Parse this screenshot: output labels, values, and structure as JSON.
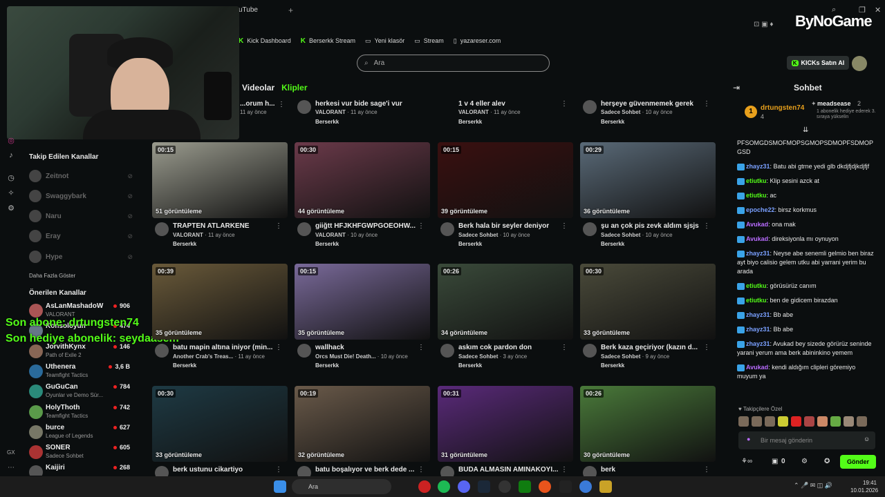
{
  "browser": {
    "tab_title": "uTube",
    "bookmarks": [
      "Kick Dashboard",
      "Berserkk Stream",
      "Yeni klasör",
      "Stream",
      "yazareser.com"
    ]
  },
  "search": {
    "placeholder": "Ara"
  },
  "tabs": {
    "videos": "Videolar",
    "clips": "Klipler"
  },
  "overlay": {
    "line1": "Son abone: drtungsten74",
    "line2": "Son hediye abonelik: seydaasem"
  },
  "sidebar": {
    "followed_title": "Takip Edilen Kanallar",
    "followed": [
      "Zeitnot",
      "Swaggybark",
      "Naru",
      "Eray",
      "Hype"
    ],
    "show_more": "Daha Fazla Göster",
    "recommended_title": "Önerilen Kanallar",
    "recommended": [
      {
        "name": "AsLanMashadoW",
        "category": "VALORANT",
        "viewers": "906"
      },
      {
        "name": "Konsoloyun",
        "category": "",
        "viewers": "474"
      },
      {
        "name": "JorvithKynx",
        "category": "Path of Exile 2",
        "viewers": "146"
      },
      {
        "name": "Uthenera",
        "category": "Teamfight Tactics",
        "viewers": "3,6 B"
      },
      {
        "name": "GuGuCan",
        "category": "Oyunlar ve Demo Sür...",
        "viewers": "784"
      },
      {
        "name": "HolyThoth",
        "category": "Teamfight Tactics",
        "viewers": "742"
      },
      {
        "name": "burce",
        "category": "League of Legends",
        "viewers": "627"
      },
      {
        "name": "SONER",
        "category": "Sadece Sohbet",
        "viewers": "605"
      },
      {
        "name": "Kaijiri",
        "category": "",
        "viewers": "268"
      }
    ]
  },
  "top_row": [
    {
      "title": "...orum h...",
      "category": "",
      "age": "11 ay önce",
      "owner": ""
    },
    {
      "title": "herkesi vur bide sage'i vur",
      "category": "VALORANT",
      "age": "11 ay önce",
      "owner": "Berserkk"
    },
    {
      "title": "1 v 4 eller alev",
      "category": "VALORANT",
      "age": "11 ay önce",
      "owner": "Berserkk"
    },
    {
      "title": "herşeye güvenmemek gerek",
      "category": "Sadece Sohbet",
      "age": "10 ay önce",
      "owner": "Berserkk"
    }
  ],
  "clips": [
    {
      "duration": "00:15",
      "views": "51 görüntüleme",
      "title": "TRAPTEN ATLARKENE",
      "category": "VALORANT",
      "age": "11 ay önce",
      "owner": "Berserkk",
      "color": "#9a9b8e"
    },
    {
      "duration": "00:30",
      "views": "44 görüntüleme",
      "title": "giiğtt HFJKHFGWPGOEOHW...",
      "category": "VALORANT",
      "age": "10 ay önce",
      "owner": "Berserkk",
      "color": "#6b3a4a"
    },
    {
      "duration": "00:15",
      "views": "39 görüntüleme",
      "title": "Berk hala bir seyler deniyor",
      "category": "Sadece Sohbet",
      "age": "10 ay önce",
      "owner": "Berserkk",
      "color": "#3a1010"
    },
    {
      "duration": "00:29",
      "views": "36 görüntüleme",
      "title": "şu an çok pis zevk aldım sjsjs",
      "category": "Sadece Sohbet",
      "age": "10 ay önce",
      "owner": "Berserkk",
      "color": "#5a6a78"
    },
    {
      "duration": "00:39",
      "views": "35 görüntüleme",
      "title": "batu mapin altına iniyor (min...",
      "category": "Another Crab's Treas...",
      "age": "11 ay önce",
      "owner": "Berserkk",
      "color": "#6a5a3a"
    },
    {
      "duration": "00:15",
      "views": "35 görüntüleme",
      "title": "wallhack",
      "category": "Orcs Must Die! Death...",
      "age": "10 ay önce",
      "owner": "Berserkk",
      "color": "#7a6a9a"
    },
    {
      "duration": "00:26",
      "views": "34 görüntüleme",
      "title": "askım cok pardon don",
      "category": "Sadece Sohbet",
      "age": "3 ay önce",
      "owner": "Berserkk",
      "color": "#3a4a3a"
    },
    {
      "duration": "00:30",
      "views": "33 görüntüleme",
      "title": "Berk kaza geçiriyor (kazın d...",
      "category": "Sadece Sohbet",
      "age": "9 ay önce",
      "owner": "Berserkk",
      "color": "#4a4a3a"
    },
    {
      "duration": "00:30",
      "views": "33 görüntüleme",
      "title": "berk ustunu cikartiyo",
      "category": "",
      "age": "",
      "owner": "",
      "color": "#1e3a44"
    },
    {
      "duration": "00:19",
      "views": "32 görüntüleme",
      "title": "batu boşalıyor ve berk dede ...",
      "category": "",
      "age": "",
      "owner": "",
      "color": "#6a5a4a"
    },
    {
      "duration": "00:31",
      "views": "31 görüntüleme",
      "title": "BUDA ALMASIN AMINAKOYI...",
      "category": "",
      "age": "",
      "owner": "",
      "color": "#5a2a7a"
    },
    {
      "duration": "00:26",
      "views": "30 görüntüleme",
      "title": "berk",
      "category": "",
      "age": "",
      "owner": "",
      "color": "#4a7a3a"
    }
  ],
  "chat": {
    "brand": "ByNoGame",
    "kicks_button": "KICKs Satın Al",
    "title": "Sohbet",
    "pinned_user": "drtungsten74",
    "pinned_count": "4",
    "pinned_user2": "meadsease",
    "pinned_count2": "2",
    "pinned_note": "1 abonelik hediye ederek 3. sıraya yükselin",
    "messages": [
      {
        "user": "",
        "text": "PFSOMGDSMOFMOPSGMOPSDMOPFSDMOPGSD",
        "color": "#e8e8e8"
      },
      {
        "user": "zhayz31",
        "text": "Batu abi gtrne yedi glb dkdjfjdjkdjfjf",
        "color": "#7aa0ff"
      },
      {
        "user": "etiutku",
        "text": "Klip sesini azck at",
        "color": "#53fc18"
      },
      {
        "user": "etiutku",
        "text": "ac",
        "color": "#53fc18"
      },
      {
        "user": "epoche22",
        "text": "birsz korkmus",
        "color": "#7aa0ff"
      },
      {
        "user": "Avukad",
        "text": "ona mak",
        "color": "#b96cff"
      },
      {
        "user": "Avukad",
        "text": "direksiyonla mı oynuyon",
        "color": "#b96cff"
      },
      {
        "user": "zhayz31",
        "text": "Neyse abe senemli gelmio ben biraz ayt biyo calisio gelem utku abi yarrani yerim bu arada",
        "color": "#7aa0ff"
      },
      {
        "user": "etiutku",
        "text": "görüsürüz canım",
        "color": "#53fc18"
      },
      {
        "user": "etiutku",
        "text": "ben de gidicem birazdan",
        "color": "#53fc18"
      },
      {
        "user": "zhayz31",
        "text": "Bb abe",
        "color": "#7aa0ff"
      },
      {
        "user": "zhayz31",
        "text": "Bb abe",
        "color": "#7aa0ff"
      },
      {
        "user": "zhayz31",
        "text": "Avukad bey sizede görürüz seninde yarani yerum ama berk abininkino yemem",
        "color": "#7aa0ff"
      },
      {
        "user": "Avukad",
        "text": "kendi aldığım clipleri göremiyo muyum ya",
        "color": "#b96cff"
      }
    ],
    "followers_label": "Takipçilere Özel",
    "input_placeholder": "Bir mesaj gönderin",
    "points": "0",
    "send": "Gönder"
  },
  "taskbar": {
    "search": "Ara",
    "time": "19:41",
    "date": "10.01.2026",
    "gx": "GX"
  }
}
